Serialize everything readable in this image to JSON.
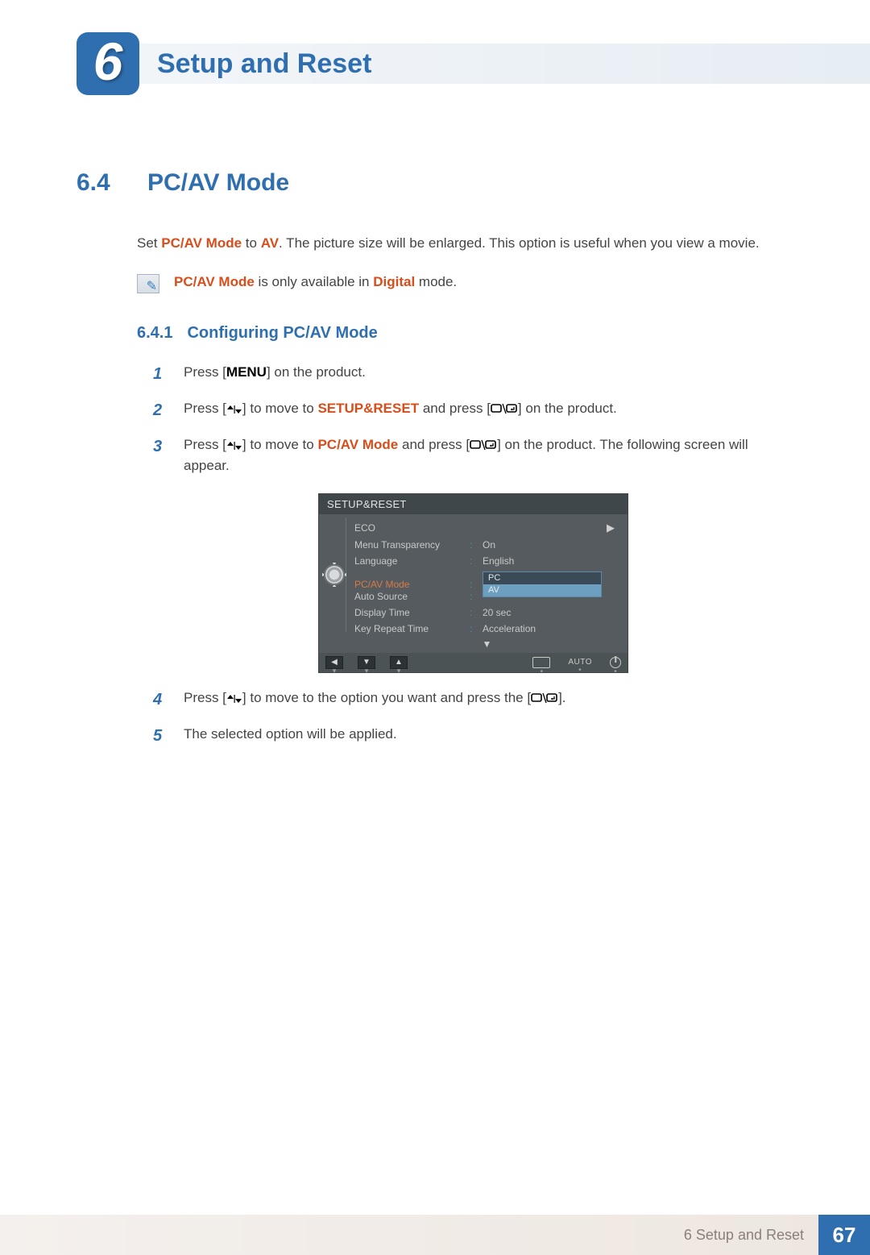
{
  "header": {
    "chapter_number": "6",
    "chapter_title": "Setup and Reset"
  },
  "section": {
    "number": "6.4",
    "title": "PC/AV Mode"
  },
  "intro": {
    "pre": "Set ",
    "bold1": "PC/AV Mode",
    "mid": " to ",
    "bold2": "AV",
    "post": ". The picture size will be enlarged. This option is useful when you view a movie."
  },
  "note": {
    "bold1": "PC/AV Mode",
    "mid": " is only available in ",
    "bold2": "Digital",
    "post": " mode."
  },
  "subsection": {
    "number": "6.4.1",
    "title": "Configuring PC/AV Mode"
  },
  "steps": {
    "s1": {
      "n": "1",
      "a": "Press [",
      "menu": "MENU",
      "b": "] on the product."
    },
    "s2": {
      "n": "2",
      "a": "Press [",
      "b": "] to move to ",
      "target": "SETUP&RESET",
      "c": " and press [",
      "d": "] on the product."
    },
    "s3": {
      "n": "3",
      "a": "Press [",
      "b": "] to move to ",
      "target": "PC/AV Mode",
      "c": " and press [",
      "d": "] on the product. The following screen will appear."
    },
    "s4": {
      "n": "4",
      "a": "Press [",
      "b": "] to move to the option you want and press the [",
      "c": "]."
    },
    "s5": {
      "n": "5",
      "a": "The selected option will be applied."
    }
  },
  "osd": {
    "title": "SETUP&RESET",
    "rows": {
      "eco": "ECO",
      "menu_transparency": {
        "label": "Menu Transparency",
        "value": "On"
      },
      "language": {
        "label": "Language",
        "value": "English"
      },
      "pcav": {
        "label": "PC/AV Mode",
        "options": [
          "PC",
          "AV"
        ],
        "selected": "PC"
      },
      "auto_source": {
        "label": "Auto Source"
      },
      "display_time": {
        "label": "Display Time",
        "value": "20 sec"
      },
      "key_repeat_time": {
        "label": "Key Repeat Time",
        "value": "Acceleration"
      }
    },
    "footer": {
      "auto": "AUTO"
    }
  },
  "footer": {
    "text": "6 Setup and Reset",
    "page": "67"
  }
}
